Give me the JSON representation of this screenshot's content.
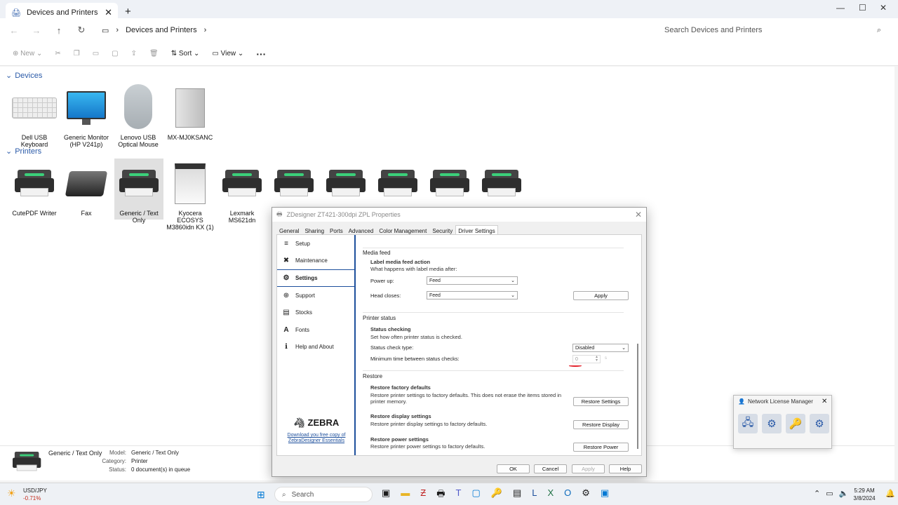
{
  "window": {
    "tab_title": "Devices and Printers",
    "new_tab": "+",
    "tab_close": "✕",
    "min": "—",
    "max": "☐",
    "close": "✕"
  },
  "nav": {
    "breadcrumb": "Devices and Printers",
    "search_placeholder": "Search Devices and Printers"
  },
  "toolbar": {
    "new": "New",
    "sort": "Sort",
    "view": "View",
    "more": "···"
  },
  "groups": {
    "devices": "Devices",
    "printers": "Printers",
    "device_items": [
      {
        "label": "Dell USB Keyboard"
      },
      {
        "label": "Generic Monitor (HP V241p)"
      },
      {
        "label": "Lenovo USB Optical Mouse"
      },
      {
        "label": "MX-MJ0KSANC"
      }
    ],
    "printer_items": [
      {
        "label": "CutePDF Writer"
      },
      {
        "label": "Fax"
      },
      {
        "label": "Generic / Text Only"
      },
      {
        "label": "Kyocera ECOSYS M3860idn KX (1)"
      },
      {
        "label": "Lexmark MS621dn"
      },
      {
        "label": ""
      },
      {
        "label": ""
      },
      {
        "label": ""
      },
      {
        "label": ""
      },
      {
        "label": ""
      }
    ]
  },
  "details": {
    "name": "Generic / Text Only",
    "model_label": "Model:",
    "model": "Generic / Text Only",
    "category_label": "Category:",
    "category": "Printer",
    "status_label": "Status:",
    "status": "0 document(s) in queue"
  },
  "dialog": {
    "title": "ZDesigner ZT421-300dpi ZPL Properties",
    "tabs": [
      "General",
      "Sharing",
      "Ports",
      "Advanced",
      "Color Management",
      "Security",
      "Driver Settings"
    ],
    "active_tab": "Driver Settings",
    "nav": [
      {
        "label": "Setup",
        "icon": "≡"
      },
      {
        "label": "Maintenance",
        "icon": "✖"
      },
      {
        "label": "Settings",
        "icon": "⚙"
      },
      {
        "label": "Support",
        "icon": "⊕"
      },
      {
        "label": "Stocks",
        "icon": "▤"
      },
      {
        "label": "Fonts",
        "icon": "A"
      },
      {
        "label": "Help and About",
        "icon": "ℹ"
      }
    ],
    "zebra_logo": "ZEBRA",
    "zebra_link": "Download you free copy of ZebraDesigner Essentials",
    "media_feed": "Media feed",
    "label_media_action": "Label media feed action",
    "label_media_desc": "What happens with label media after:",
    "power_up_label": "Power up:",
    "power_up_value": "Feed",
    "head_closes_label": "Head closes:",
    "head_closes_value": "Feed",
    "apply_inner": "Apply",
    "printer_status": "Printer status",
    "status_checking": "Status checking",
    "status_checking_desc": "Set how often printer status is checked.",
    "status_check_type_label": "Status check type:",
    "status_check_type_value": "Disabled",
    "min_time_label": "Minimum time between status checks:",
    "min_time_value": "0",
    "min_time_unit": "s",
    "restore": "Restore",
    "restore_factory": "Restore factory defaults",
    "restore_factory_desc": "Restore printer settings to factory defaults. This does not erase the items stored in printer memory.",
    "restore_settings_btn": "Restore Settings",
    "restore_display": "Restore display settings",
    "restore_display_desc": "Restore printer display settings to factory defaults.",
    "restore_display_btn": "Restore Display",
    "restore_power": "Restore power settings",
    "restore_power_desc": "Restore printer power settings to factory defaults.",
    "restore_power_btn": "Restore Power",
    "ok": "OK",
    "cancel": "Cancel",
    "apply": "Apply",
    "help": "Help"
  },
  "nlm": {
    "title": "Network License Manager",
    "close": "✕"
  },
  "taskbar": {
    "ticker": "USD/JPY",
    "ticker_change": "-0.71%",
    "search": "Search",
    "time": "5:29 AM",
    "date": "3/8/2024"
  },
  "colors": {
    "accent": "#1d4f9c",
    "group_header": "#2a5aa8",
    "ticker_change": "#c42b1c"
  }
}
